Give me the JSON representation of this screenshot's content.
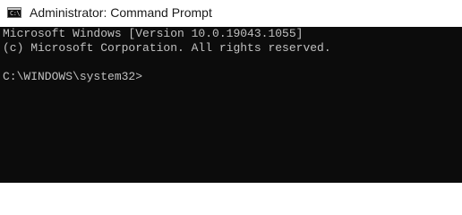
{
  "window": {
    "title": "Administrator: Command Prompt",
    "icon": "cmd-icon",
    "icon_glyph": "C:\\"
  },
  "console": {
    "lines": [
      "Microsoft Windows [Version 10.0.19043.1055]",
      "(c) Microsoft Corporation. All rights reserved.",
      "",
      "C:\\WINDOWS\\system32>"
    ]
  },
  "colors": {
    "console_background": "#0c0c0c",
    "console_text": "#c0c0c0",
    "titlebar_background": "#ffffff",
    "title_text": "#1a1a1a"
  }
}
